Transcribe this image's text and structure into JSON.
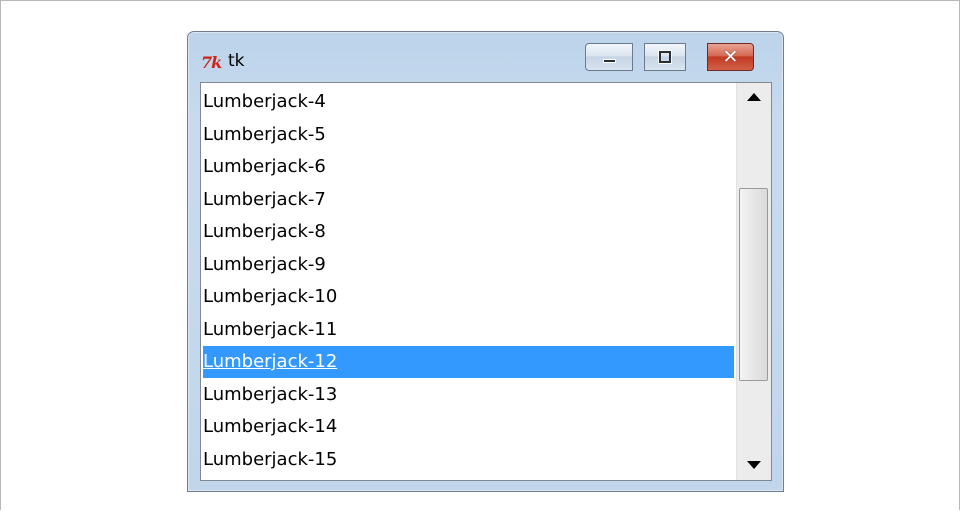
{
  "window": {
    "title": "tk",
    "logo_text": "7k",
    "buttons": {
      "minimize_icon": "minimize-icon",
      "maximize_icon": "maximize-icon",
      "close_icon": "close-icon",
      "close_glyph": "✕"
    }
  },
  "listbox": {
    "items": [
      "Lumberjack-4",
      "Lumberjack-5",
      "Lumberjack-6",
      "Lumberjack-7",
      "Lumberjack-8",
      "Lumberjack-9",
      "Lumberjack-10",
      "Lumberjack-11",
      "Lumberjack-12",
      "Lumberjack-13",
      "Lumberjack-14",
      "Lumberjack-15"
    ],
    "selected_item": "Lumberjack-12"
  },
  "scrollbar": {
    "position_fraction": 0.22,
    "visible_fraction": 0.58
  },
  "colors": {
    "selection": "#3399ff",
    "close_button": "#c23a22"
  }
}
